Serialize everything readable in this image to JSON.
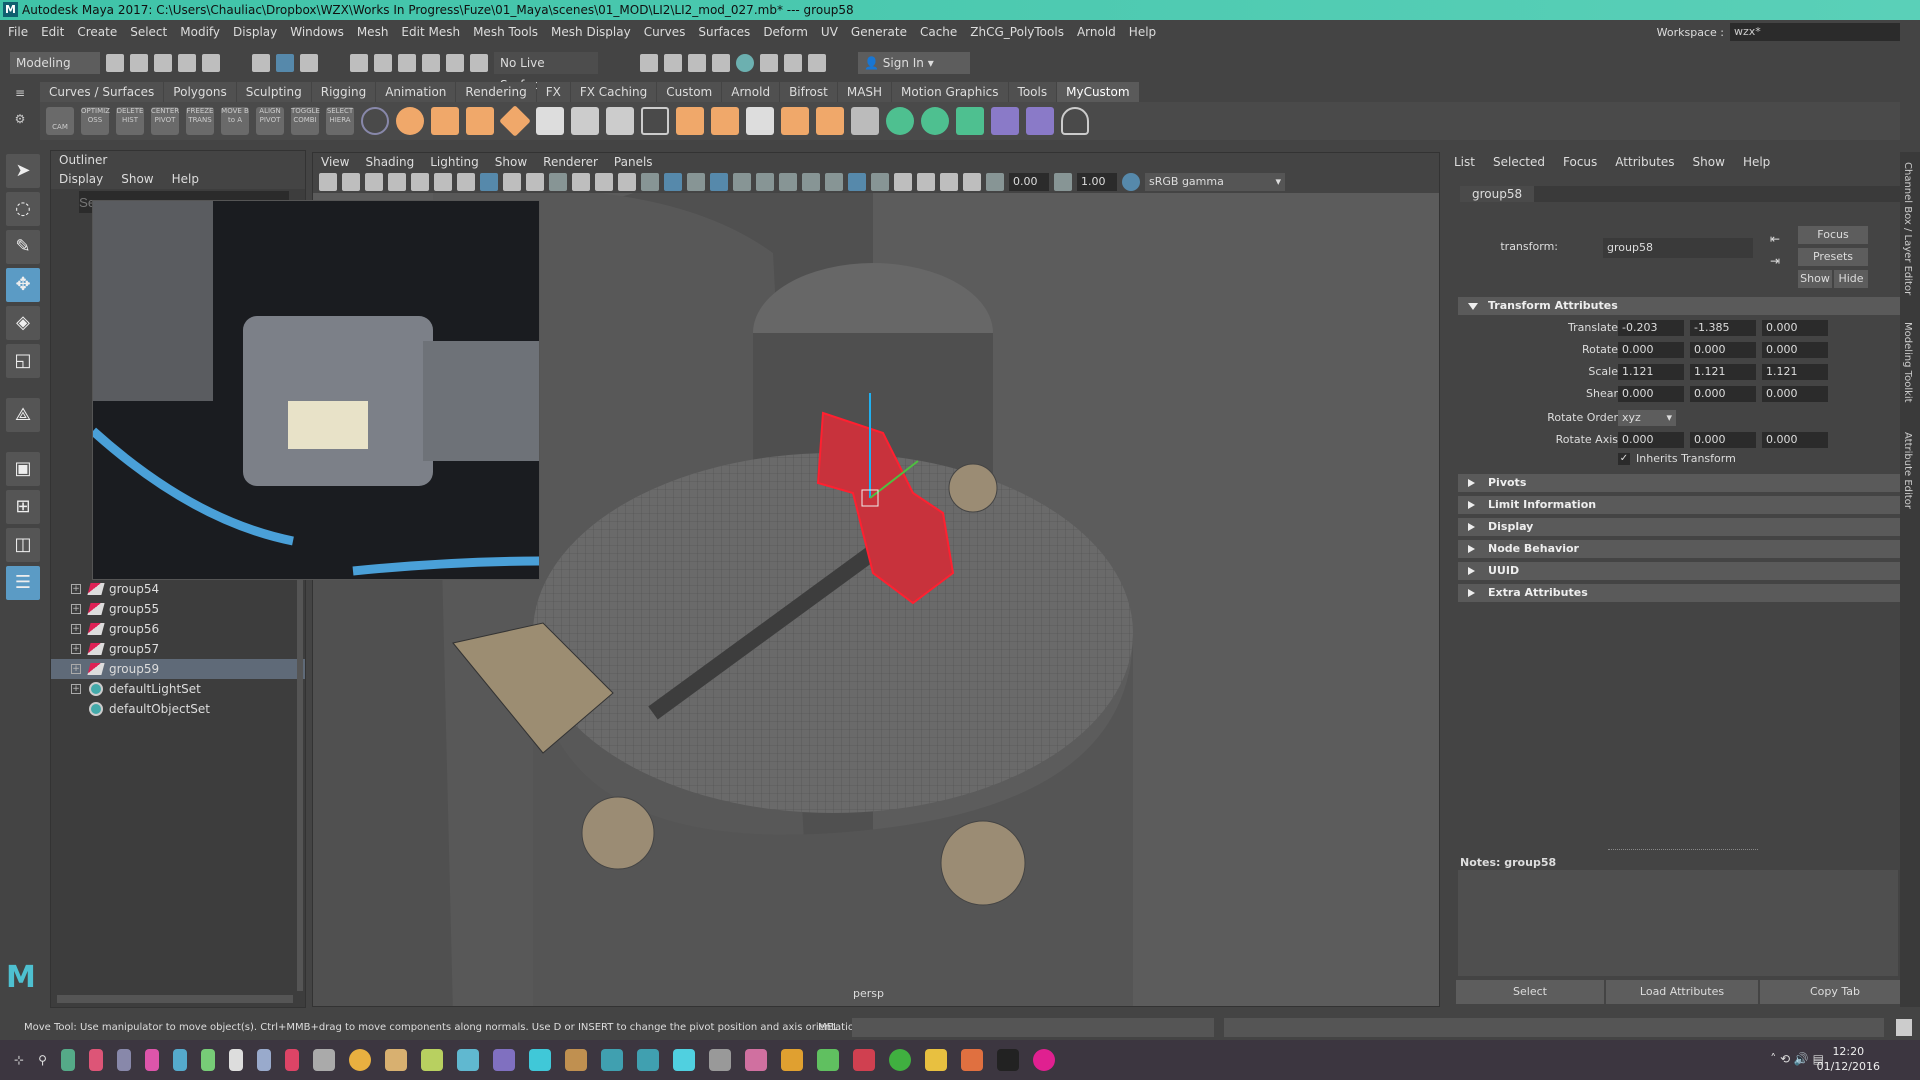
{
  "title": "Autodesk Maya 2017: C:\\Users\\Chauliac\\Dropbox\\WZX\\Works In Progress\\Fuze\\01_Maya\\scenes\\01_MOD\\LI2\\LI2_mod_027.mb*  ---  group58",
  "menu": [
    "File",
    "Edit",
    "Create",
    "Select",
    "Modify",
    "Display",
    "Windows",
    "Mesh",
    "Edit Mesh",
    "Mesh Tools",
    "Mesh Display",
    "Curves",
    "Surfaces",
    "Deform",
    "UV",
    "Generate",
    "Cache",
    "ZhCG_PolyTools",
    "Arnold",
    "Help"
  ],
  "workspace": {
    "label": "Workspace :",
    "value": "wzx*"
  },
  "statusline": {
    "mode": "Modeling",
    "live_surface": "No Live Surface",
    "sign_in": "Sign In"
  },
  "shelf": {
    "tabs": [
      "Curves / Surfaces",
      "Polygons",
      "Sculpting",
      "Rigging",
      "Animation",
      "Rendering",
      "FX",
      "FX Caching",
      "Custom",
      "Arnold",
      "Bifrost",
      "MASH",
      "Motion Graphics",
      "Tools",
      "MyCustom"
    ],
    "active_tab": "MyCustom",
    "custom_buttons": [
      "CAM",
      "OPTIMIZ OSS",
      "DELETE HIST",
      "CENTER PIVOT",
      "FREEZE TRANS",
      "MOVE B to A",
      "ALIGN PIVOT",
      "TOGGLE COMBI",
      "SELECT HIERA"
    ]
  },
  "outliner": {
    "title": "Outliner",
    "menu": [
      "Display",
      "Show",
      "Help"
    ],
    "search_placeholder": "Se",
    "items": [
      {
        "name": "group54",
        "type": "group",
        "selected": false
      },
      {
        "name": "group55",
        "type": "group",
        "selected": false
      },
      {
        "name": "group56",
        "type": "group",
        "selected": false
      },
      {
        "name": "group57",
        "type": "group",
        "selected": false
      },
      {
        "name": "group59",
        "type": "group",
        "selected": true
      },
      {
        "name": "defaultLightSet",
        "type": "set",
        "selected": false
      },
      {
        "name": "defaultObjectSet",
        "type": "set",
        "selected": false
      }
    ]
  },
  "viewport": {
    "menu": [
      "View",
      "Shading",
      "Lighting",
      "Show",
      "Renderer",
      "Panels"
    ],
    "exposure": "0.00",
    "gamma": "1.00",
    "color_space": "sRGB gamma",
    "camera": "persp"
  },
  "attribute_editor": {
    "menu": [
      "List",
      "Selected",
      "Focus",
      "Attributes",
      "Show",
      "Help"
    ],
    "node_tab": "group58",
    "transform_label": "transform:",
    "transform_value": "group58",
    "buttons": {
      "focus": "Focus",
      "presets": "Presets",
      "show": "Show",
      "hide": "Hide"
    },
    "transform_section": "Transform Attributes",
    "rows": [
      {
        "label": "Translate",
        "values": [
          "-0.203",
          "-1.385",
          "0.000"
        ]
      },
      {
        "label": "Rotate",
        "values": [
          "0.000",
          "0.000",
          "0.000"
        ]
      },
      {
        "label": "Scale",
        "values": [
          "1.121",
          "1.121",
          "1.121"
        ]
      },
      {
        "label": "Shear",
        "values": [
          "0.000",
          "0.000",
          "0.000"
        ]
      }
    ],
    "rotate_order": {
      "label": "Rotate Order",
      "value": "xyz"
    },
    "rotate_axis": {
      "label": "Rotate Axis",
      "values": [
        "0.000",
        "0.000",
        "0.000"
      ]
    },
    "inherits_transform": {
      "label": "Inherits Transform",
      "checked": true
    },
    "sections": [
      "Pivots",
      "Limit Information",
      "Display",
      "Node Behavior",
      "UUID",
      "Extra Attributes"
    ],
    "notes_label": "Notes:  group58",
    "bottom_buttons": [
      "Select",
      "Load Attributes",
      "Copy Tab"
    ]
  },
  "side_tabs": [
    "Channel Box / Layer Editor",
    "Modeling Toolkit",
    "Attribute Editor"
  ],
  "helpline": "Move Tool: Use manipulator to move object(s). Ctrl+MMB+drag to move components along normals. Use D or INSERT to change the pivot position and axis orientation.",
  "command_line_label": "MEL",
  "clock": {
    "time": "12:20",
    "date": "01/12/2016"
  },
  "colors": {
    "title_bar": "#3fc3a8",
    "selection": "#5b9bc5",
    "selected_mesh": "#e02030",
    "taskbar": "#3c3640"
  }
}
